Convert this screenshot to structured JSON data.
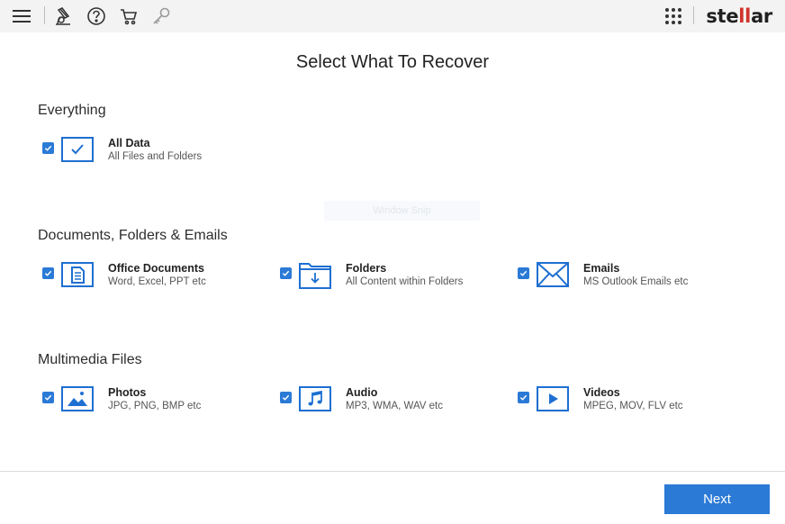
{
  "toolbar": {
    "icons": [
      "menu-icon",
      "scan-engine-icon",
      "help-icon",
      "cart-icon",
      "key-icon",
      "apps-grid-icon"
    ],
    "logo": {
      "part1": "ste",
      "part2": "ll",
      "part3": "ar"
    }
  },
  "page_title": "Select What To Recover",
  "sections": {
    "everything": "Everything",
    "documents": "Documents, Folders & Emails",
    "multimedia": "Multimedia Files"
  },
  "options": {
    "all_data": {
      "title": "All Data",
      "subtitle": "All Files and Folders",
      "checked": true
    },
    "office_documents": {
      "title": "Office Documents",
      "subtitle": "Word, Excel, PPT etc",
      "checked": true
    },
    "folders": {
      "title": "Folders",
      "subtitle": "All Content within Folders",
      "checked": true
    },
    "emails": {
      "title": "Emails",
      "subtitle": "MS Outlook Emails etc",
      "checked": true
    },
    "photos": {
      "title": "Photos",
      "subtitle": "JPG, PNG, BMP etc",
      "checked": true
    },
    "audio": {
      "title": "Audio",
      "subtitle": "MP3, WMA, WAV etc",
      "checked": true
    },
    "videos": {
      "title": "Videos",
      "subtitle": "MPEG, MOV, FLV etc",
      "checked": true
    }
  },
  "watermark": "Window Snip",
  "next_label": "Next",
  "colors": {
    "accent": "#2b7ad6",
    "brand_red": "#d0342c",
    "toolbar_bg": "#f3f3f3"
  }
}
